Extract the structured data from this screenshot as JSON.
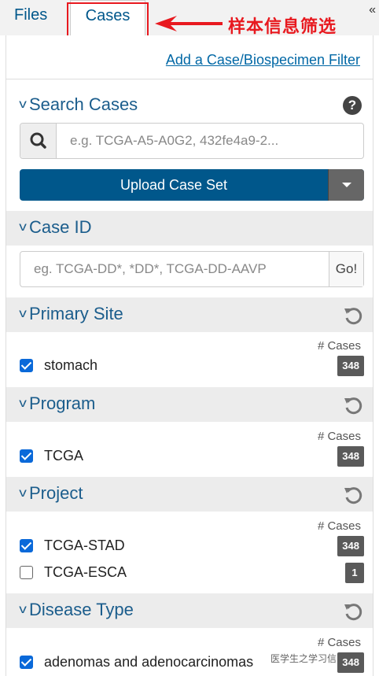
{
  "tabs": {
    "files": "Files",
    "cases": "Cases",
    "collapse": "«"
  },
  "annotation": {
    "text": "样本信息筛选",
    "color": "#e8191f"
  },
  "panel": {
    "add_filter": "Add a Case/Biospecimen Filter",
    "search": {
      "title": "Search Cases",
      "placeholder": "e.g. TCGA-A5-A0G2, 432fe4a9-2...",
      "upload_label": "Upload Case Set"
    },
    "case_id": {
      "title": "Case ID",
      "placeholder": "eg. TCGA-DD*, *DD*, TCGA-DD-AAVP",
      "go": "Go!"
    },
    "count_header": "# Cases",
    "facets": [
      {
        "title": "Primary Site",
        "items": [
          {
            "label": "stomach",
            "count": "348",
            "checked": true
          }
        ]
      },
      {
        "title": "Program",
        "items": [
          {
            "label": "TCGA",
            "count": "348",
            "checked": true
          }
        ]
      },
      {
        "title": "Project",
        "items": [
          {
            "label": "TCGA-STAD",
            "count": "348",
            "checked": true
          },
          {
            "label": "TCGA-ESCA",
            "count": "1",
            "checked": false
          }
        ]
      },
      {
        "title": "Disease Type",
        "items": [
          {
            "label": "adenomas and adenocarcinomas",
            "count": "348",
            "checked": true
          }
        ]
      }
    ]
  },
  "watermark": "医学生之学习信",
  "colors": {
    "primary": "#00578b",
    "link": "#0067a5",
    "checkbox": "#0a69d9",
    "badge": "#5a5a5a"
  }
}
